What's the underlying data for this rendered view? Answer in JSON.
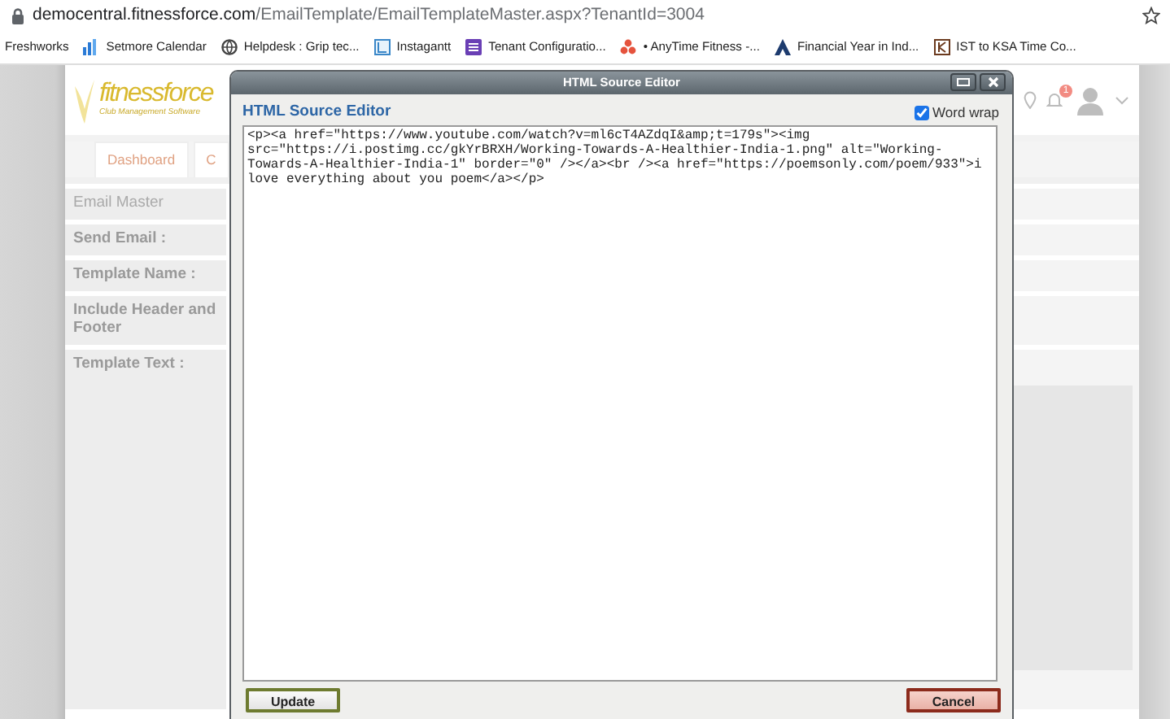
{
  "browser": {
    "url_host": "democentral.fitnessforce.com",
    "url_path": "/EmailTemplate/EmailTemplateMaster.aspx?TenantId=3004",
    "bookmarks": [
      {
        "label": "Freshworks"
      },
      {
        "label": "Setmore Calendar"
      },
      {
        "label": "Helpdesk : Grip tec..."
      },
      {
        "label": "Instagantt"
      },
      {
        "label": "Tenant Configuratio..."
      },
      {
        "label": "• AnyTime Fitness -..."
      },
      {
        "label": "Financial Year in Ind..."
      },
      {
        "label": "IST to KSA Time Co..."
      }
    ]
  },
  "page": {
    "logo_name": "fitnessforce",
    "logo_tagline": "Club Management Software",
    "notification_count": "1",
    "tabs": [
      {
        "label": "Dashboard"
      },
      {
        "label": "C"
      }
    ],
    "form_rows": [
      {
        "label": "Email Master",
        "kind": "header"
      },
      {
        "label": "Send Email :",
        "kind": "label"
      },
      {
        "label": "Template Name :",
        "kind": "label"
      },
      {
        "label": "Include Header and Footer",
        "kind": "label"
      },
      {
        "label": "Template Text :",
        "kind": "editor"
      }
    ]
  },
  "dialog": {
    "title": "HTML Source Editor",
    "heading": "HTML Source Editor",
    "word_wrap": {
      "label": "Word wrap",
      "checked": true
    },
    "source": "<p><a href=\"https://www.youtube.com/watch?v=ml6cT4AZdqI&amp;t=179s\"><img src=\"https://i.postimg.cc/gkYrBRXH/Working-Towards-A-Healthier-India-1.png\" alt=\"Working-Towards-A-Healthier-India-1\" border=\"0\" /></a><br /><a href=\"https://poemsonly.com/poem/933\">i love everything about you poem</a></p>",
    "buttons": [
      {
        "label": "Update",
        "kind": "update"
      },
      {
        "label": "Cancel",
        "kind": "cancel"
      }
    ]
  }
}
